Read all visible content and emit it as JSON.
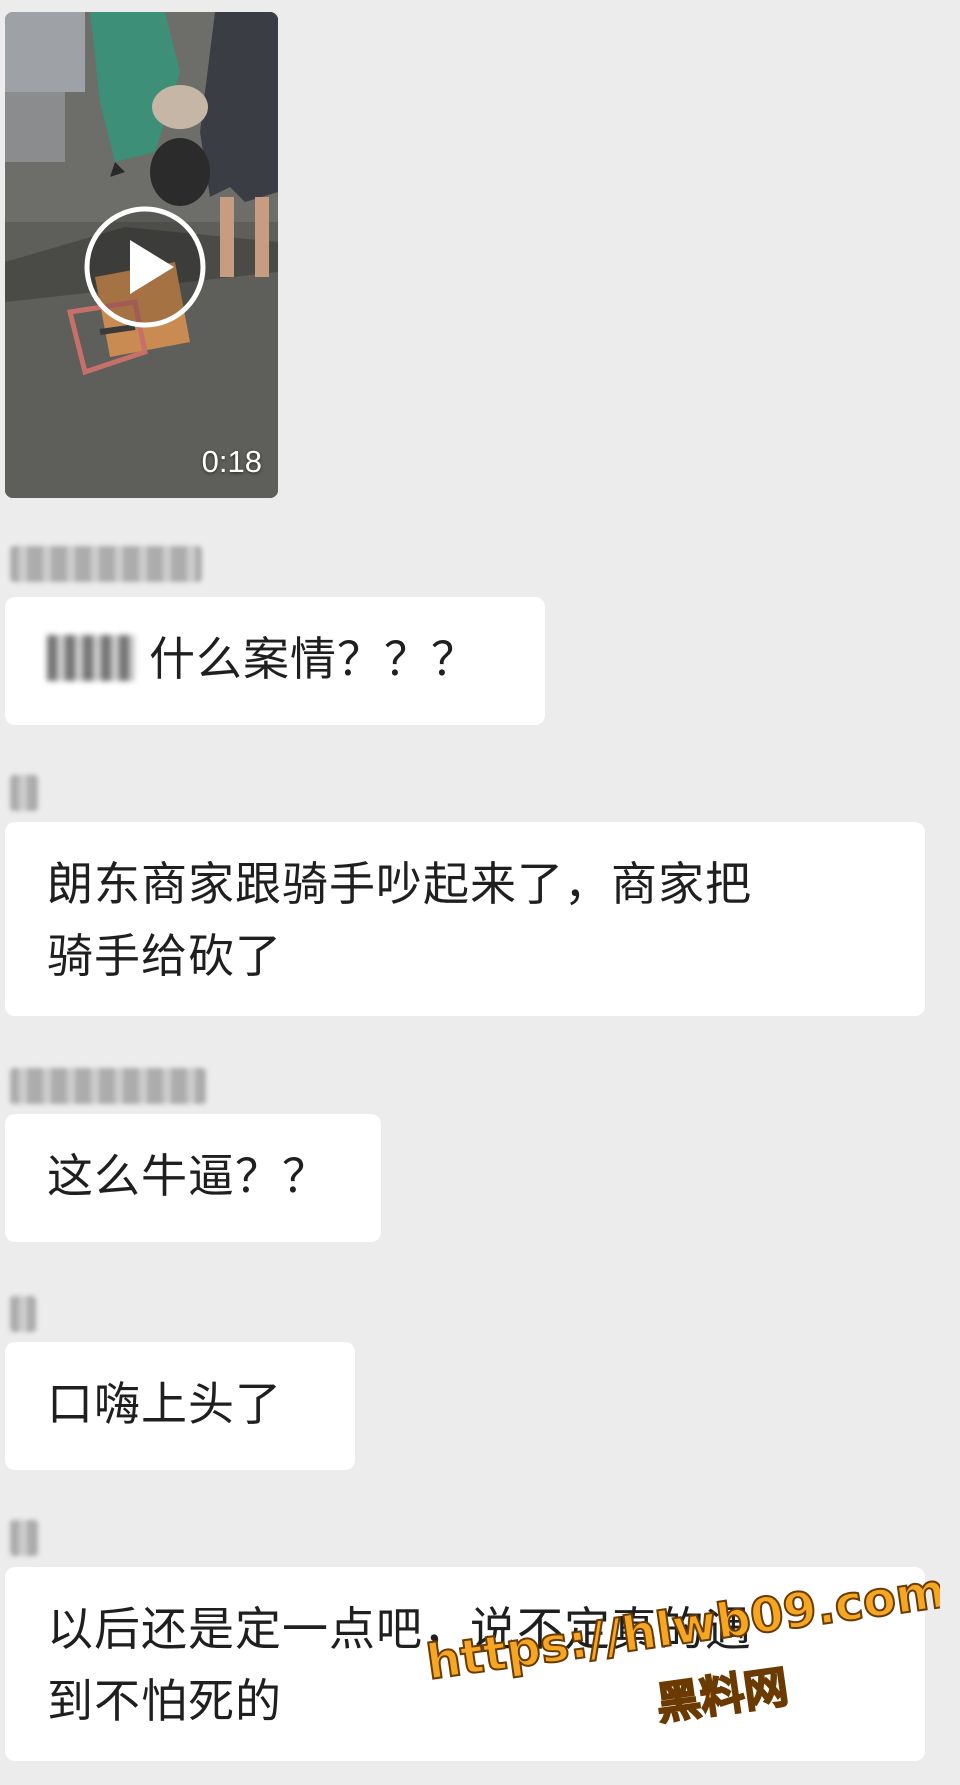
{
  "video": {
    "duration": "0:18",
    "play_icon": "play-circle-icon"
  },
  "messages": [
    {
      "sender_obscured": true,
      "mention_obscured": true,
      "lines": [
        "什么案情？？？"
      ]
    },
    {
      "sender_obscured": true,
      "lines": [
        "朗东商家跟骑手吵起来了，商家把",
        "骑手给砍了"
      ]
    },
    {
      "sender_obscured": true,
      "lines": [
        "这么牛逼？？"
      ]
    },
    {
      "sender_obscured": true,
      "lines": [
        "口嗨上头了"
      ]
    },
    {
      "sender_obscured": true,
      "lines": [
        "以后还是定一点吧，说不定真的遇",
        "到不怕死的"
      ]
    }
  ],
  "watermark": {
    "url": "https://hlwb09.com",
    "label": "黑料网",
    "color": "#f5a623"
  },
  "colors": {
    "background": "#ececec",
    "bubble": "#ffffff",
    "text": "#1f1f1f"
  }
}
